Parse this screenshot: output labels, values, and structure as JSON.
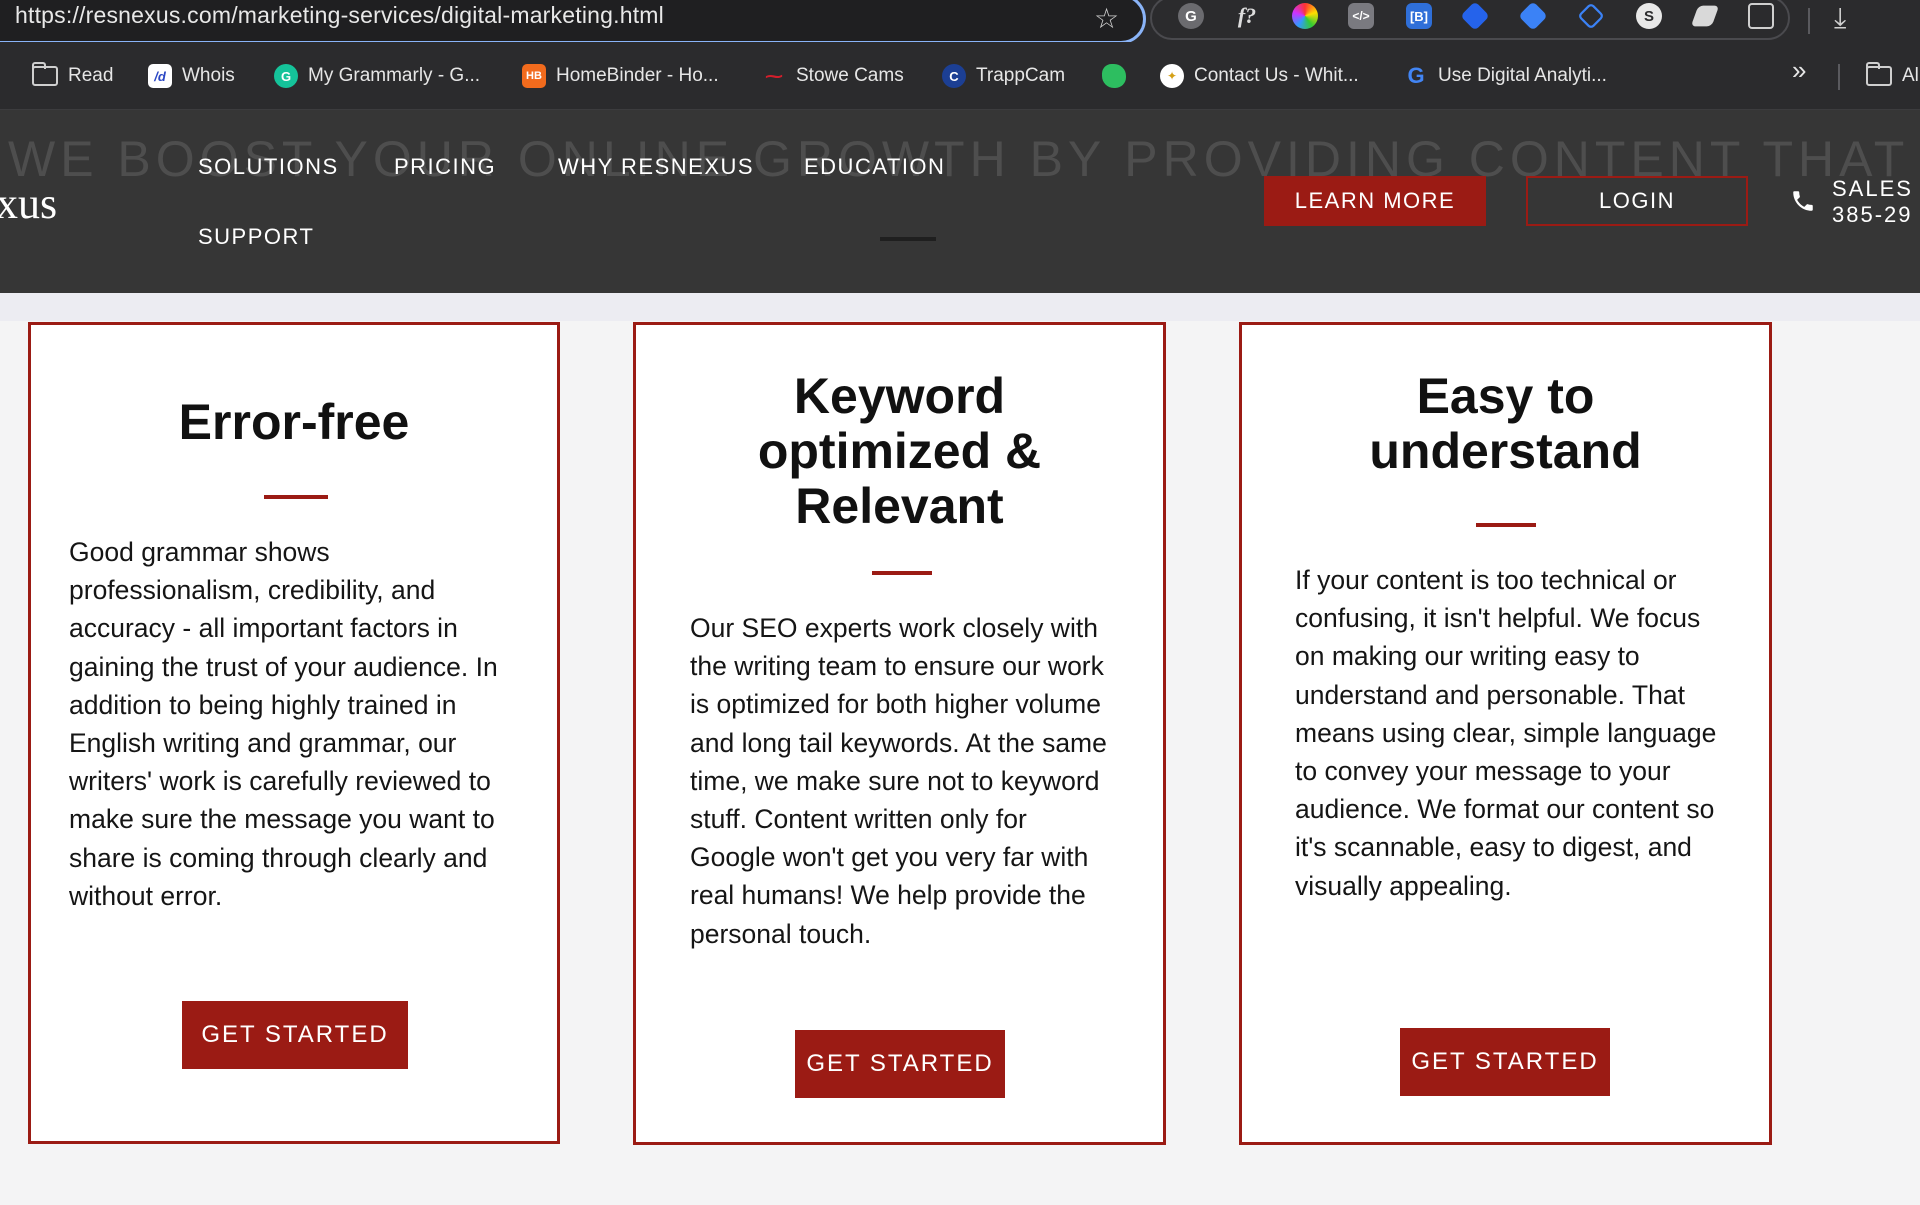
{
  "browser": {
    "url": "https://resnexus.com/marketing-services/digital-marketing.html",
    "bookmarks": [
      {
        "label": "Read",
        "icon": "folder-icon"
      },
      {
        "label": "Whois",
        "icon": "whois-icon"
      },
      {
        "label": "My Grammarly - G...",
        "icon": "grammarly-icon"
      },
      {
        "label": "HomeBinder - Ho...",
        "icon": "homebinder-icon"
      },
      {
        "label": "Stowe Cams",
        "icon": "stowe-icon"
      },
      {
        "label": "TrappCam",
        "icon": "trappcam-icon"
      },
      {
        "label": "",
        "icon": "evernote-icon"
      },
      {
        "label": "Contact Us - Whit...",
        "icon": "contact-icon"
      },
      {
        "label": "Use Digital Analyti...",
        "icon": "google-icon"
      },
      {
        "label": "Al",
        "icon": "folder-icon"
      }
    ],
    "overflow": "»"
  },
  "header": {
    "background_headline": "WE BOOST YOUR ONLINE GROWTH BY PROVIDING CONTENT THAT IS...",
    "logo_fragment": "xus",
    "nav": [
      "SOLUTIONS",
      "PRICING",
      "WHY RESNEXUS",
      "EDUCATION",
      "SUPPORT"
    ],
    "learn_more": "LEARN MORE",
    "login": "LOGIN",
    "sales_label": "SALES",
    "sales_phone": "385-29"
  },
  "colors": {
    "accent": "#9b1b14",
    "header_bg": "#363636"
  },
  "cards": [
    {
      "title_lines": [
        "Error-free"
      ],
      "body": "Good grammar shows professionalism, credibility, and accuracy - all important factors in gaining the trust of your audience. In addition to being highly trained in English writing and grammar, our writers' work is carefully reviewed to make sure the message you want to share is coming through clearly and without error.",
      "button": "GET STARTED"
    },
    {
      "title_lines": [
        "Keyword",
        "optimized &",
        "Relevant"
      ],
      "body": "Our SEO experts work closely with the writing team to ensure our work is optimized for both higher volume and long tail keywords. At the same time, we make sure not to keyword stuff. Content written only for Google won't get you very far with real humans! We help provide the personal touch.",
      "button": "GET STARTED"
    },
    {
      "title_lines": [
        "Easy to",
        "understand"
      ],
      "body": "If your content is too technical or confusing, it isn't helpful. We focus on making our writing easy to understand and personable. That means using clear, simple language to convey your message to your audience. We format our content so it's scannable, easy to digest, and visually appealing.",
      "button": "GET STARTED"
    }
  ]
}
